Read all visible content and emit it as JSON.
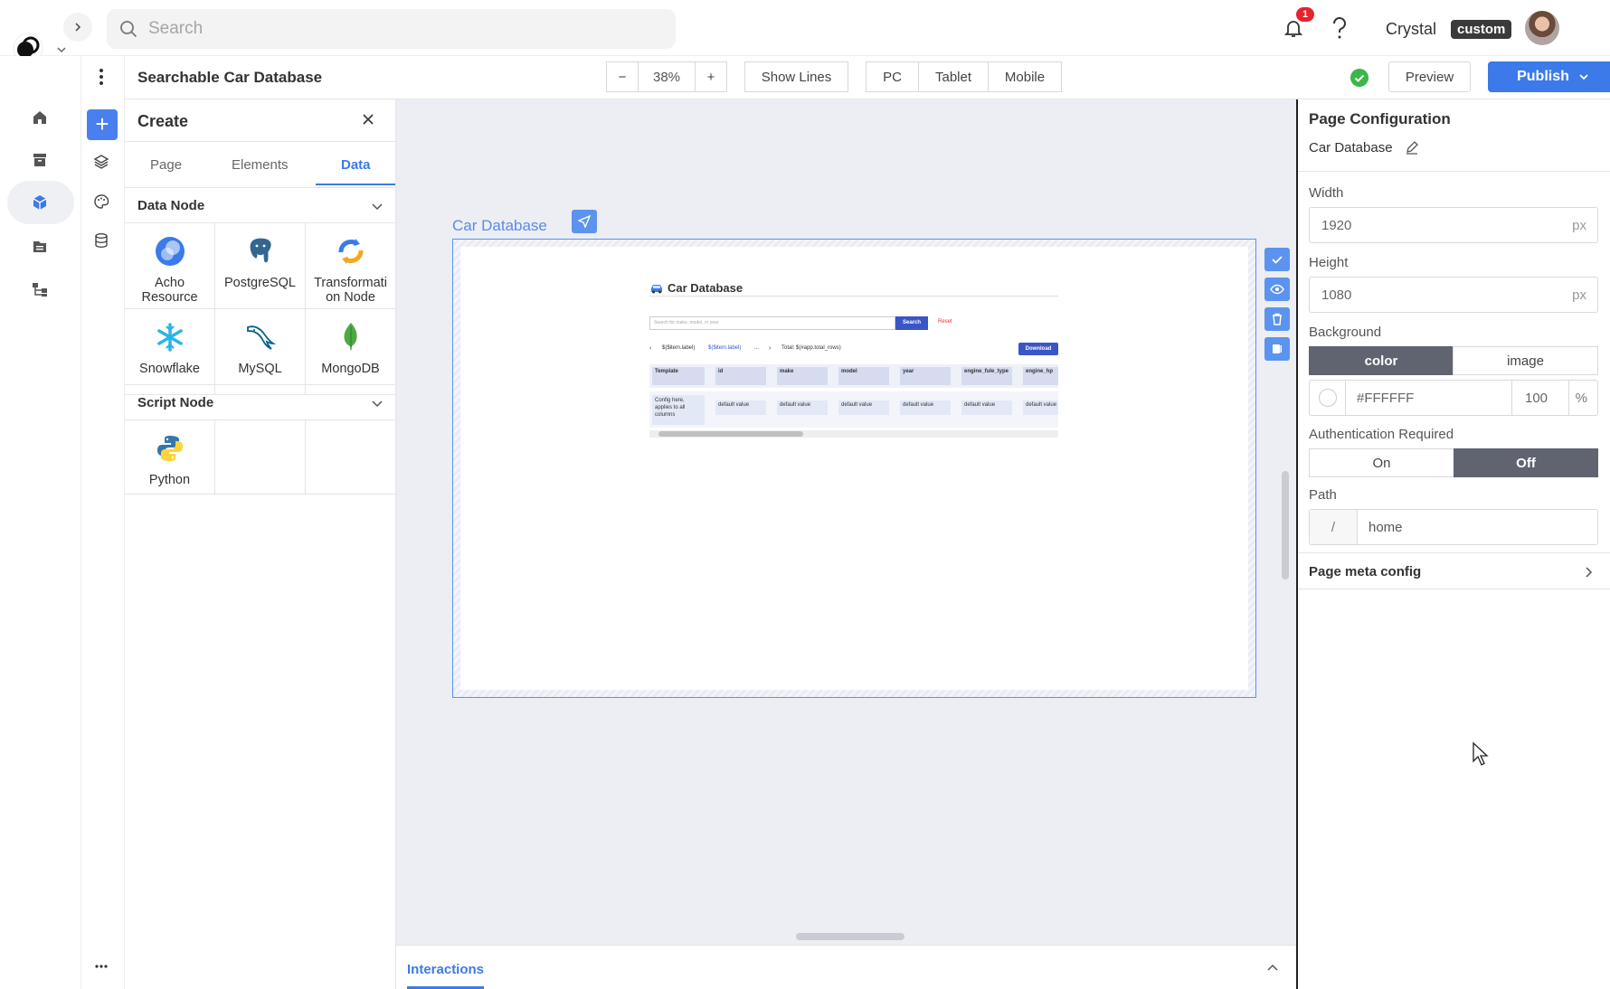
{
  "header": {
    "search_placeholder": "Search",
    "notification_count": "1",
    "username": "Crystal",
    "role_badge": "custom"
  },
  "toolbar": {
    "page_title": "Searchable Car Database",
    "zoom_minus": "−",
    "zoom_value": "38%",
    "zoom_plus": "+",
    "show_lines": "Show Lines",
    "devices": [
      "PC",
      "Tablet",
      "Mobile"
    ],
    "preview": "Preview",
    "publish": "Publish"
  },
  "create_panel": {
    "title": "Create",
    "tabs": [
      "Page",
      "Elements",
      "Data"
    ],
    "active_tab": "Data",
    "data_node_title": "Data Node",
    "data_nodes": [
      "Acho Resource",
      "PostgreSQL",
      "Transformation Node",
      "Snowflake",
      "MySQL",
      "MongoDB"
    ],
    "data_node_lines": [
      [
        "Acho",
        "Resource"
      ],
      [
        "PostgreSQL",
        ""
      ],
      [
        "Transformati",
        "on Node"
      ],
      [
        "Snowflake",
        ""
      ],
      [
        "MySQL",
        ""
      ],
      [
        "MongoDB",
        ""
      ]
    ],
    "script_node_title": "Script Node",
    "script_nodes": [
      "Python"
    ]
  },
  "canvas": {
    "page_label": "Car Database",
    "mini": {
      "title": "Car Database",
      "search_placeholder": "Search for make, model, or year",
      "search_button": "Search",
      "reset": "Reset",
      "pager_prev": "‹",
      "pager_items": [
        "$($item.label)",
        "$($item.label)",
        "...",
        "›"
      ],
      "total": "Total: $(#app.total_rows)",
      "download": "Download",
      "columns": [
        "Template",
        "id",
        "make",
        "model",
        "year",
        "engine_fule_type",
        "engine_hp"
      ],
      "template_note": "Config here, applies to all columns",
      "cell_value": "default value"
    }
  },
  "interactions": {
    "label": "Interactions"
  },
  "config": {
    "title": "Page Configuration",
    "page_name": "Car Database",
    "width_label": "Width",
    "width_value": "1920",
    "height_label": "Height",
    "height_value": "1080",
    "unit": "px",
    "background_label": "Background",
    "bg_options": [
      "color",
      "image"
    ],
    "bg_selected": "color",
    "bg_color": "#FFFFFF",
    "bg_opacity": "100",
    "percent": "%",
    "auth_label": "Authentication Required",
    "auth_options": [
      "On",
      "Off"
    ],
    "auth_selected": "Off",
    "path_label": "Path",
    "path_prefix": "/",
    "path_value": "home",
    "meta_label": "Page meta config"
  }
}
